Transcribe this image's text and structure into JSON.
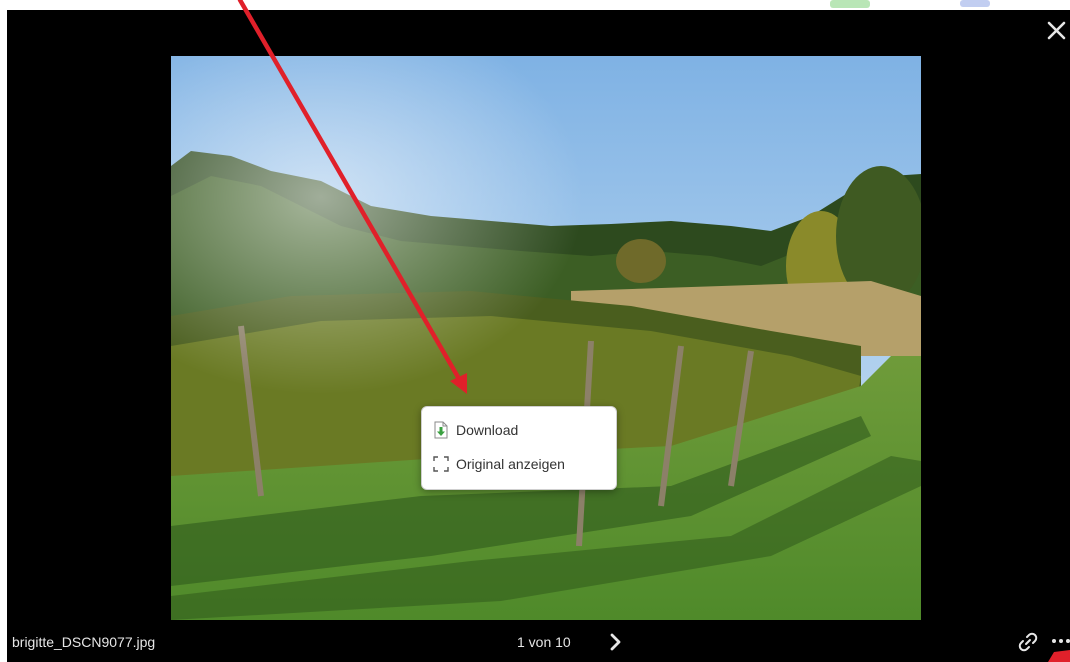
{
  "viewer": {
    "filename": "brigitte_DSCN9077.jpg",
    "counter": "1 von 10",
    "close_icon": "close-icon",
    "next_icon": "chevron-right-icon",
    "link_icon": "link-icon",
    "more_icon": "more-horizontal-icon"
  },
  "context_menu": {
    "items": [
      {
        "label": "Download",
        "icon": "download-file-icon"
      },
      {
        "label": "Original anzeigen",
        "icon": "fullscreen-icon"
      }
    ]
  },
  "colors": {
    "viewer_background": "#000000",
    "annotation_arrow": "#e0202a",
    "download_icon_green": "#3aa040"
  }
}
